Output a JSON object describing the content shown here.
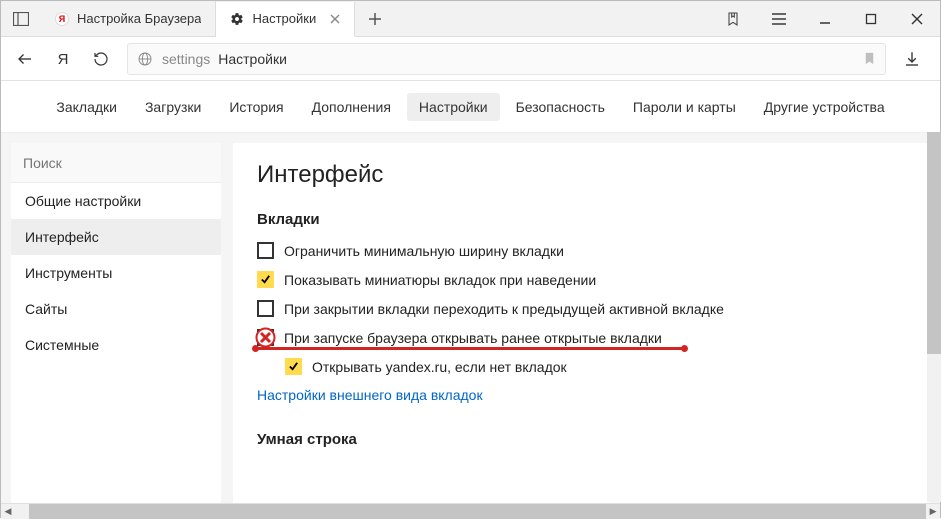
{
  "tabs": [
    {
      "label": "Настройка Браузера"
    },
    {
      "label": "Настройки"
    }
  ],
  "address": {
    "url": "settings",
    "title": "Настройки"
  },
  "topnav": {
    "items": [
      "Закладки",
      "Загрузки",
      "История",
      "Дополнения",
      "Настройки",
      "Безопасность",
      "Пароли и карты",
      "Другие устройства"
    ],
    "current_index": 4
  },
  "sidebar": {
    "search_placeholder": "Поиск",
    "items": [
      "Общие настройки",
      "Интерфейс",
      "Инструменты",
      "Сайты",
      "Системные"
    ],
    "selected_index": 1
  },
  "main": {
    "heading": "Интерфейс",
    "tabs_section": {
      "title": "Вкладки",
      "options": [
        {
          "label": "Ограничить минимальную ширину вкладки",
          "checked": false
        },
        {
          "label": "Показывать миниатюры вкладок при наведении",
          "checked": true
        },
        {
          "label": "При закрытии вкладки переходить к предыдущей активной вкладке",
          "checked": false
        },
        {
          "label": "При запуске браузера открывать ранее открытые вкладки",
          "checked": false,
          "x_marker": true
        },
        {
          "label": "Открывать yandex.ru, если нет вкладок",
          "checked": true,
          "indent": true
        }
      ],
      "link": "Настройки внешнего вида вкладок"
    },
    "smartline_section": {
      "title": "Умная строка"
    }
  }
}
